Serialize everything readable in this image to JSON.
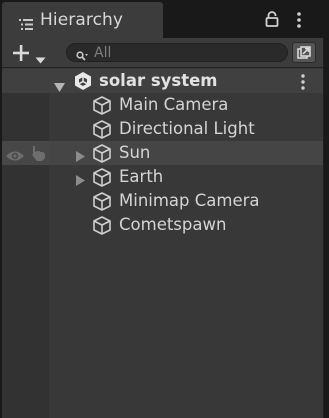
{
  "tab": {
    "title": "Hierarchy"
  },
  "toolbar": {
    "search_placeholder": "All"
  },
  "scene": {
    "name": "solar system"
  },
  "items": [
    {
      "label": "Main Camera",
      "has_children": false
    },
    {
      "label": "Directional Light",
      "has_children": false
    },
    {
      "label": "Sun",
      "has_children": true
    },
    {
      "label": "Earth",
      "has_children": true
    },
    {
      "label": "Minimap Camera",
      "has_children": false
    },
    {
      "label": "Cometspawn",
      "has_children": false
    }
  ],
  "colors": {
    "background": "#383838",
    "tab_background": "#3c3c3c",
    "hover_row": "#454545",
    "text": "#d4d4d4"
  }
}
